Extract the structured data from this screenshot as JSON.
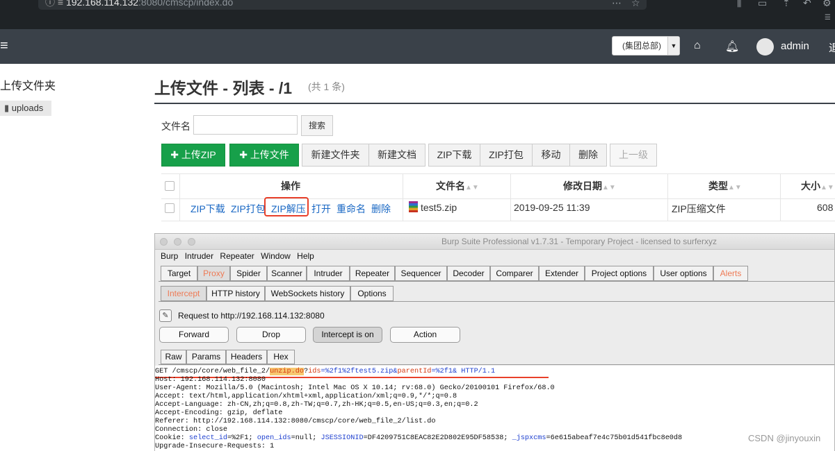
{
  "browser": {
    "url_host": "192.168.114.132",
    "url_path": ":8080/cmscp/index.do",
    "menu_glyph": "⋯",
    "bookmark_glyph": "☆"
  },
  "header": {
    "org_select": "(集团总部)",
    "username": "admin",
    "right_cut": "退"
  },
  "sidebar": {
    "title": "上传文件夹",
    "items": [
      {
        "label": "uploads"
      }
    ]
  },
  "page": {
    "title": "上传文件 - 列表 - /1",
    "count": "(共 1 条)"
  },
  "search": {
    "label": "文件名",
    "placeholder": "",
    "button": "搜索"
  },
  "toolbar": {
    "buttons": [
      "上传ZIP",
      "上传文件",
      "新建文件夹",
      "新建文档",
      "ZIP下载",
      "ZIP打包",
      "移动",
      "删除",
      "上一级"
    ]
  },
  "table": {
    "headers": [
      "操作",
      "文件名",
      "修改日期",
      "类型",
      "大小"
    ],
    "rows": [
      {
        "actions": [
          "ZIP下载",
          "ZIP打包",
          "ZIP解压",
          "打开",
          "重命名",
          "删除"
        ],
        "name": "test5.zip",
        "date": "2019-09-25 11:39",
        "type": "ZIP压缩文件",
        "size": "608"
      }
    ]
  },
  "burp": {
    "title": "Burp Suite Professional v1.7.31 - Temporary Project - licensed to surferxyz",
    "menu": [
      "Burp",
      "Intruder",
      "Repeater",
      "Window",
      "Help"
    ],
    "tabs": [
      "Target",
      "Proxy",
      "Spider",
      "Scanner",
      "Intruder",
      "Repeater",
      "Sequencer",
      "Decoder",
      "Comparer",
      "Extender",
      "Project options",
      "User options",
      "Alerts"
    ],
    "subtabs": [
      "Intercept",
      "HTTP history",
      "WebSockets history",
      "Options"
    ],
    "request_to": "Request to http://192.168.114.132:8080",
    "buttons": [
      "Forward",
      "Drop",
      "Intercept is on",
      "Action"
    ],
    "view_tabs": [
      "Raw",
      "Params",
      "Headers",
      "Hex"
    ],
    "request_line": {
      "pre": "GET /cmscp/core/web_file_2/",
      "highlight": "unzip.do",
      "q": "?",
      "p1": "ids",
      "v1": "=%2f1%2ftest5.zip&",
      "p2": "parentId",
      "v2": "=%2f1& HTTP/1.1"
    },
    "lines": [
      "Host: 192.168.114.132:8080",
      "User-Agent: Mozilla/5.0 (Macintosh; Intel Mac OS X 10.14; rv:68.0) Gecko/20100101 Firefox/68.0",
      "Accept: text/html,application/xhtml+xml,application/xml;q=0.9,*/*;q=0.8",
      "Accept-Language: zh-CN,zh;q=0.8,zh-TW;q=0.7,zh-HK;q=0.5,en-US;q=0.3,en;q=0.2",
      "Accept-Encoding: gzip, deflate",
      "Referer: http://192.168.114.132:8080/cmscp/core/web_file_2/list.do",
      "Connection: close"
    ],
    "cookie": {
      "k": "Cookie: ",
      "n1": "select_id",
      "v1": "=%2F1; ",
      "n2": "open_ids",
      "v2": "=null; ",
      "n3": "JSESSIONID",
      "v3": "=DF4209751C8EAC82E2D802E95DF58538; ",
      "n4": "_jspxcms",
      "v4": "=6e615abeaf7e4c75b01d541fbc8e0d8"
    },
    "last_line": "Upgrade-Insecure-Requests: 1"
  },
  "watermark": "CSDN @jinyouxin"
}
